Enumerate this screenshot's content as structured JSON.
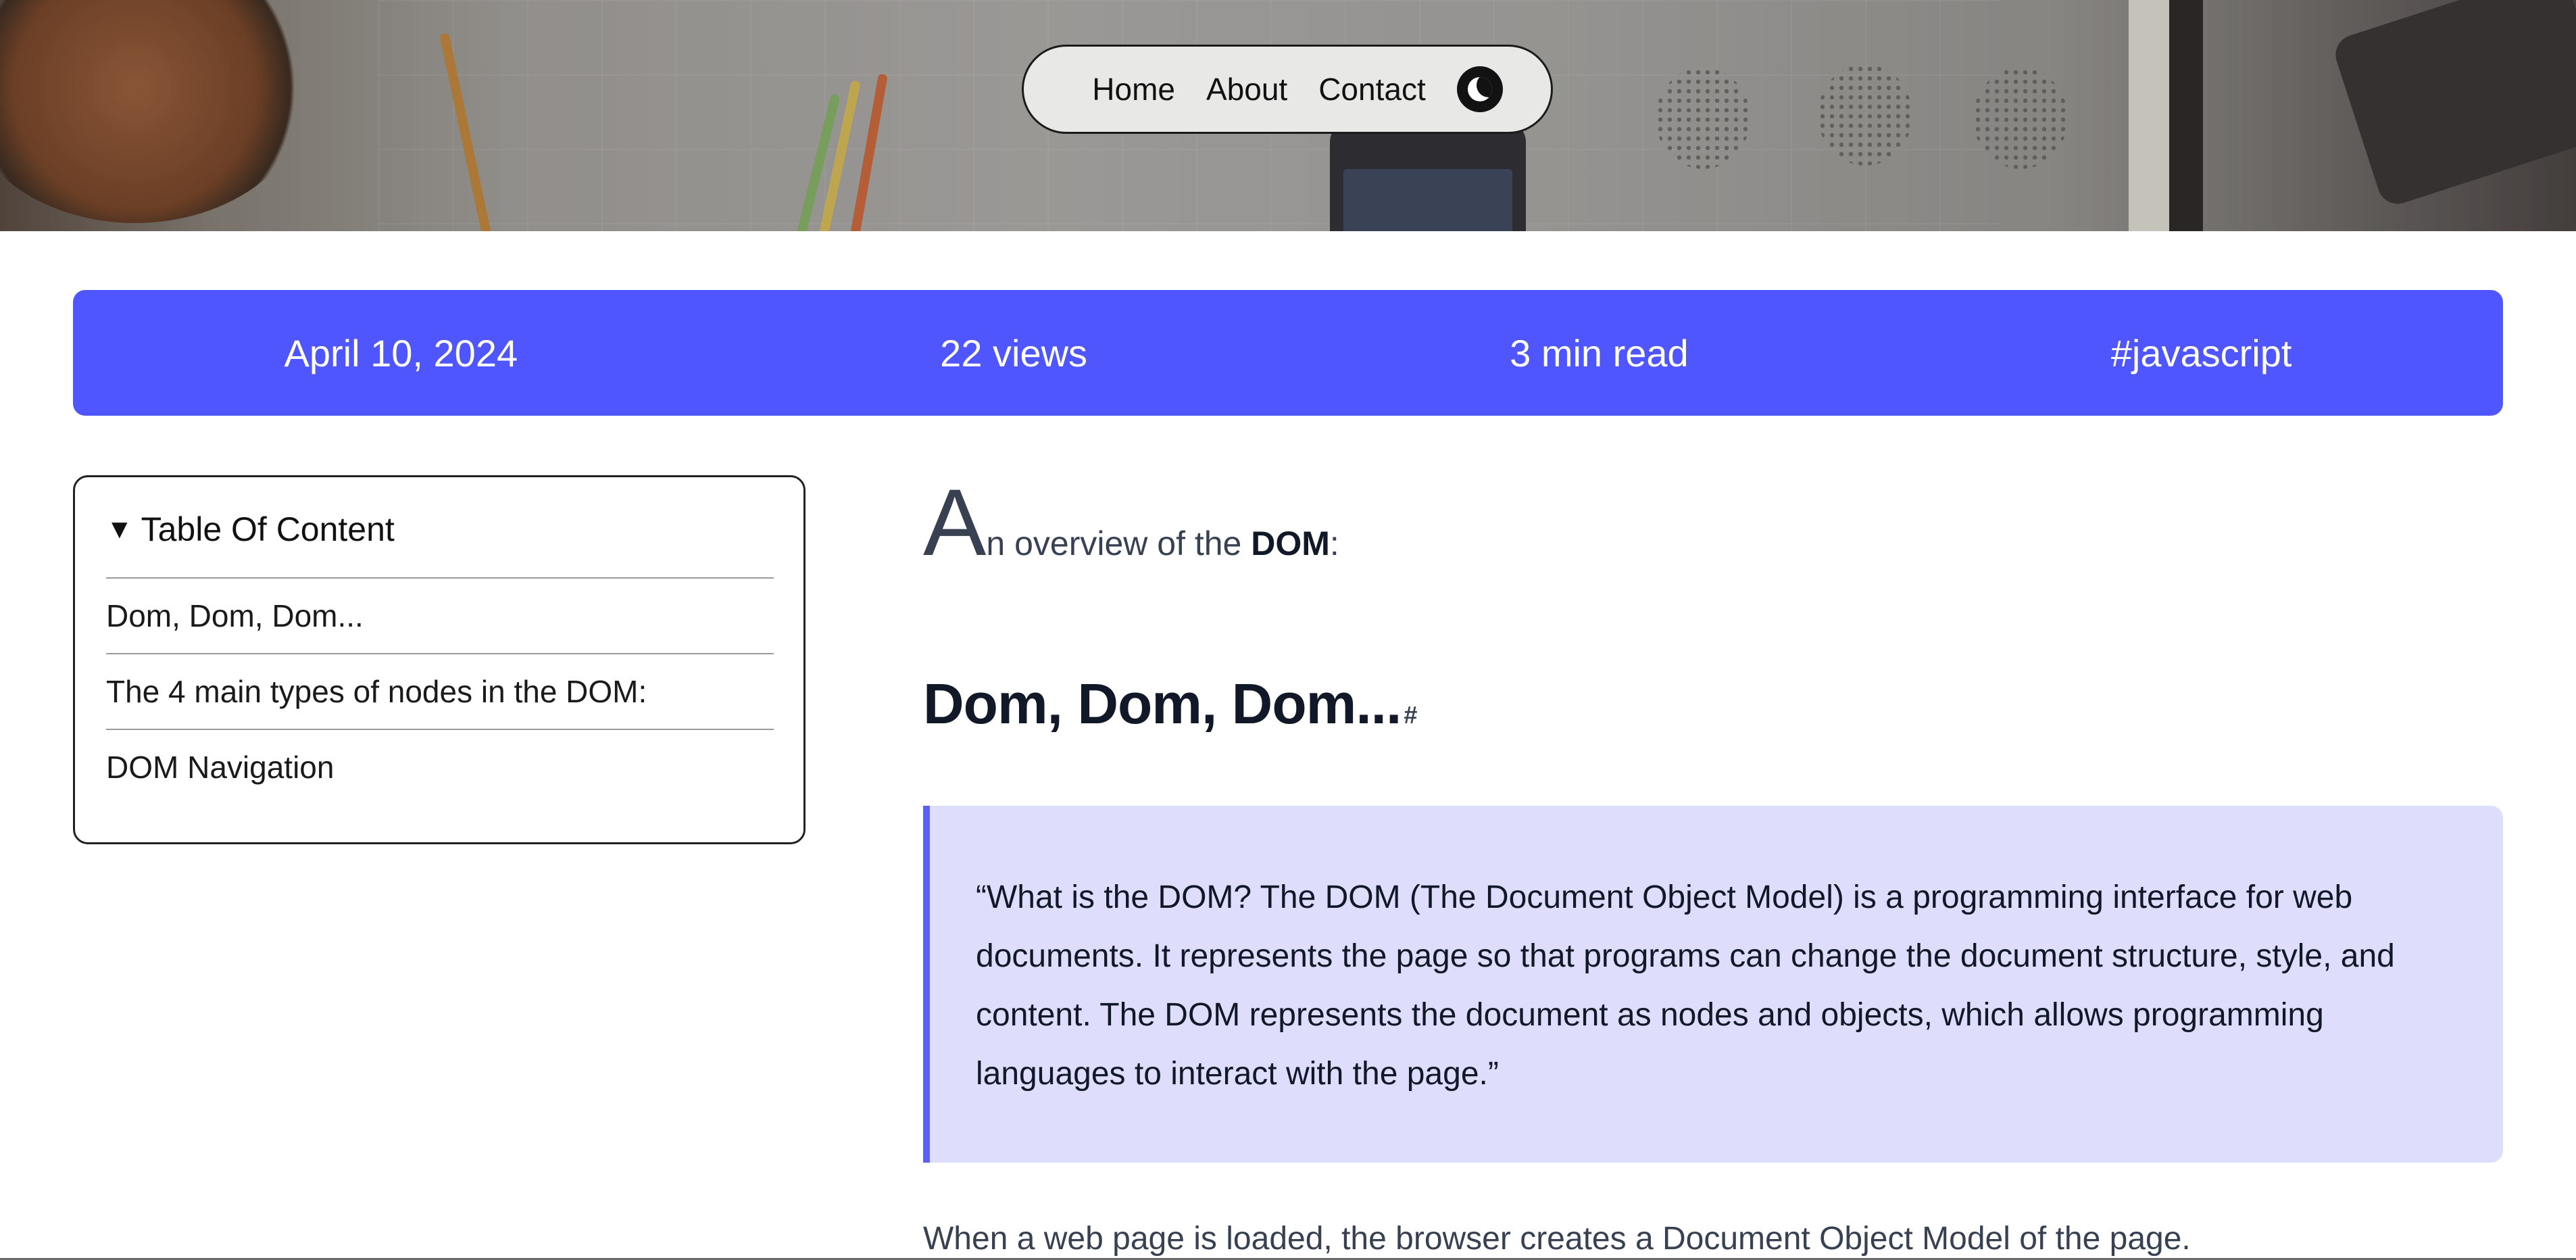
{
  "nav": {
    "links": [
      "Home",
      "About",
      "Contact"
    ],
    "theme_toggle_icon": "moon-icon"
  },
  "meta": {
    "date": "April 10, 2024",
    "views": "22 views",
    "read_time": "3 min read",
    "tag": "#javascript"
  },
  "toc": {
    "title": "Table Of Content",
    "toggle_glyph": "▼",
    "items": [
      "Dom, Dom, Dom...",
      "The 4 main types of nodes in the DOM:",
      "DOM Navigation"
    ]
  },
  "article": {
    "lead_drop": "A",
    "lead_rest": "n overview of the ",
    "lead_bold": "DOM",
    "lead_colon": ":",
    "heading": "Dom, Dom, Dom...",
    "heading_anchor": "#",
    "quote": "“What is the DOM? The DOM (The Document Object Model) is a programming interface for web documents. It represents the page so that programs can change the document structure, style, and content. The DOM represents the document as nodes and objects, which allows programming languages to interact with the page.”",
    "paragraph": "When a web page is loaded, the browser creates a Document Object Model of the page."
  },
  "colors": {
    "accent": "#4f56fe",
    "quote_bg": "#dedefc",
    "quote_border": "#5b5ff2"
  }
}
